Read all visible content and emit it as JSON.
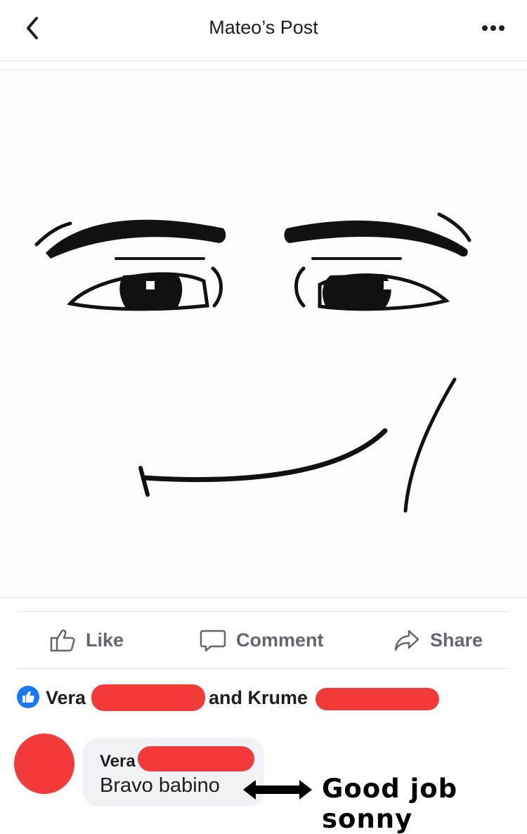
{
  "header": {
    "title": "Mateo’s Post"
  },
  "post": {
    "image_subject": "drawn-face"
  },
  "actions": {
    "like": "Like",
    "comment": "Comment",
    "share": "Share"
  },
  "reactions": {
    "name1": "Vera",
    "connector": "and Krume"
  },
  "comment": {
    "author": "Vera",
    "text": "Bravo babino"
  },
  "annotation": {
    "text": "Good job sonny"
  },
  "colors": {
    "brand": "#1877f2",
    "redaction": "#f23a3a",
    "text_secondary": "#606770"
  }
}
